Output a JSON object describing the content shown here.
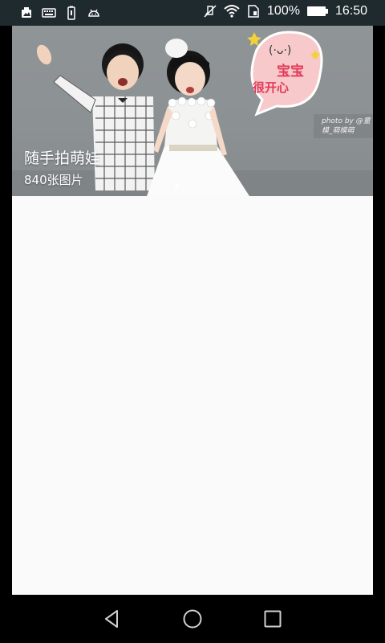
{
  "status_bar": {
    "battery_percent": "100%",
    "time": "16:50",
    "left_icons": [
      "photo-icon",
      "keyboard-icon",
      "battery-saver-icon",
      "android-debug-icon"
    ],
    "right_icons": [
      "mute-icon",
      "wifi-icon",
      "sim-icon",
      "battery-icon"
    ]
  },
  "banner": {
    "title": "随手拍萌娃",
    "count": "840张图片",
    "sticker_text": "宝宝很开心",
    "credit": "photo by @童模_萌模萌",
    "active_page": 1
  },
  "nav_bar": {
    "buttons": [
      "back-icon",
      "home-icon",
      "recents-icon"
    ]
  },
  "colors": {
    "status_bg": "#1f2a2e",
    "content_bg": "#fafafa",
    "nav_bg": "#000000"
  }
}
